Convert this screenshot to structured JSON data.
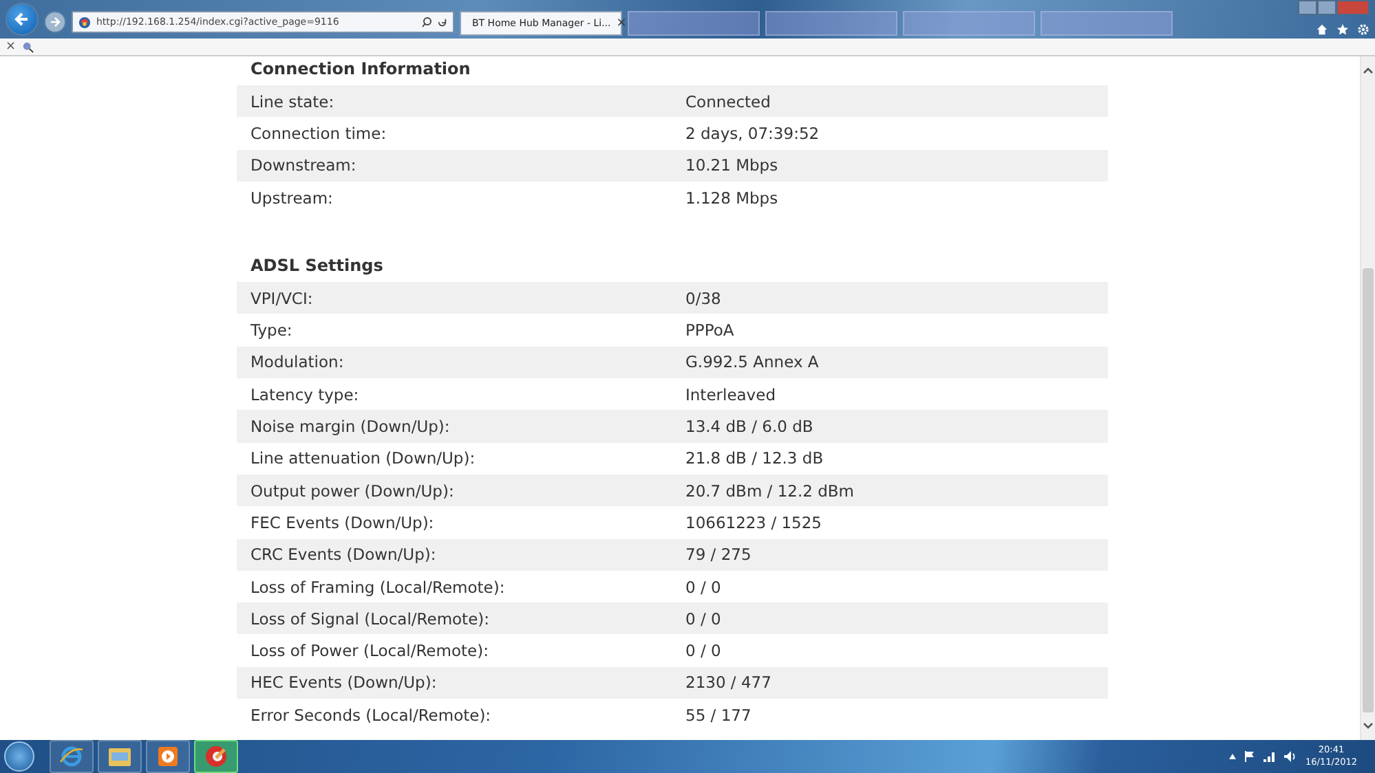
{
  "browser": {
    "address": "http://192.168.1.254/index.cgi?active_page=9116",
    "tabs": [
      {
        "label": "BT Home Hub Manager - Li...",
        "close": "×",
        "selected": true
      },
      {
        "selected": false
      },
      {
        "selected": false
      },
      {
        "selected": false
      },
      {
        "selected": false
      }
    ],
    "command_bar": {
      "close": "×"
    }
  },
  "sections": [
    {
      "title": "Connection Information",
      "rows": [
        {
          "label": "Line state:",
          "value": "Connected"
        },
        {
          "label": "Connection time:",
          "value": "2 days, 07:39:52"
        },
        {
          "label": "Downstream:",
          "value": "10.21 Mbps"
        },
        {
          "label": "Upstream:",
          "value": "1.128 Mbps"
        }
      ]
    },
    {
      "title": "ADSL Settings",
      "rows": [
        {
          "label": "VPI/VCI:",
          "value": "0/38"
        },
        {
          "label": "Type:",
          "value": "PPPoA"
        },
        {
          "label": "Modulation:",
          "value": "G.992.5 Annex A"
        },
        {
          "label": "Latency type:",
          "value": "Interleaved"
        },
        {
          "label": "Noise margin (Down/Up):",
          "value": "13.4 dB / 6.0 dB"
        },
        {
          "label": "Line attenuation (Down/Up):",
          "value": "21.8 dB / 12.3 dB"
        },
        {
          "label": "Output power (Down/Up):",
          "value": "20.7 dBm / 12.2 dBm"
        },
        {
          "label": "FEC Events (Down/Up):",
          "value": "10661223 / 1525"
        },
        {
          "label": "CRC Events (Down/Up):",
          "value": "79 / 275"
        },
        {
          "label": "Loss of Framing (Local/Remote):",
          "value": "0 / 0"
        },
        {
          "label": "Loss of Signal (Local/Remote):",
          "value": "0 / 0"
        },
        {
          "label": "Loss of Power (Local/Remote):",
          "value": "0 / 0"
        },
        {
          "label": "HEC Events (Down/Up):",
          "value": "2130 / 477"
        },
        {
          "label": "Error Seconds (Local/Remote):",
          "value": "55 / 177"
        }
      ]
    }
  ],
  "taskbar": {
    "apps": [
      {
        "kind": "ie",
        "selected": false
      },
      {
        "kind": "folder",
        "selected": false
      },
      {
        "kind": "media",
        "selected": false
      },
      {
        "kind": "cleaner",
        "selected": true
      }
    ],
    "time": "20:41",
    "date": "16/11/2012"
  }
}
